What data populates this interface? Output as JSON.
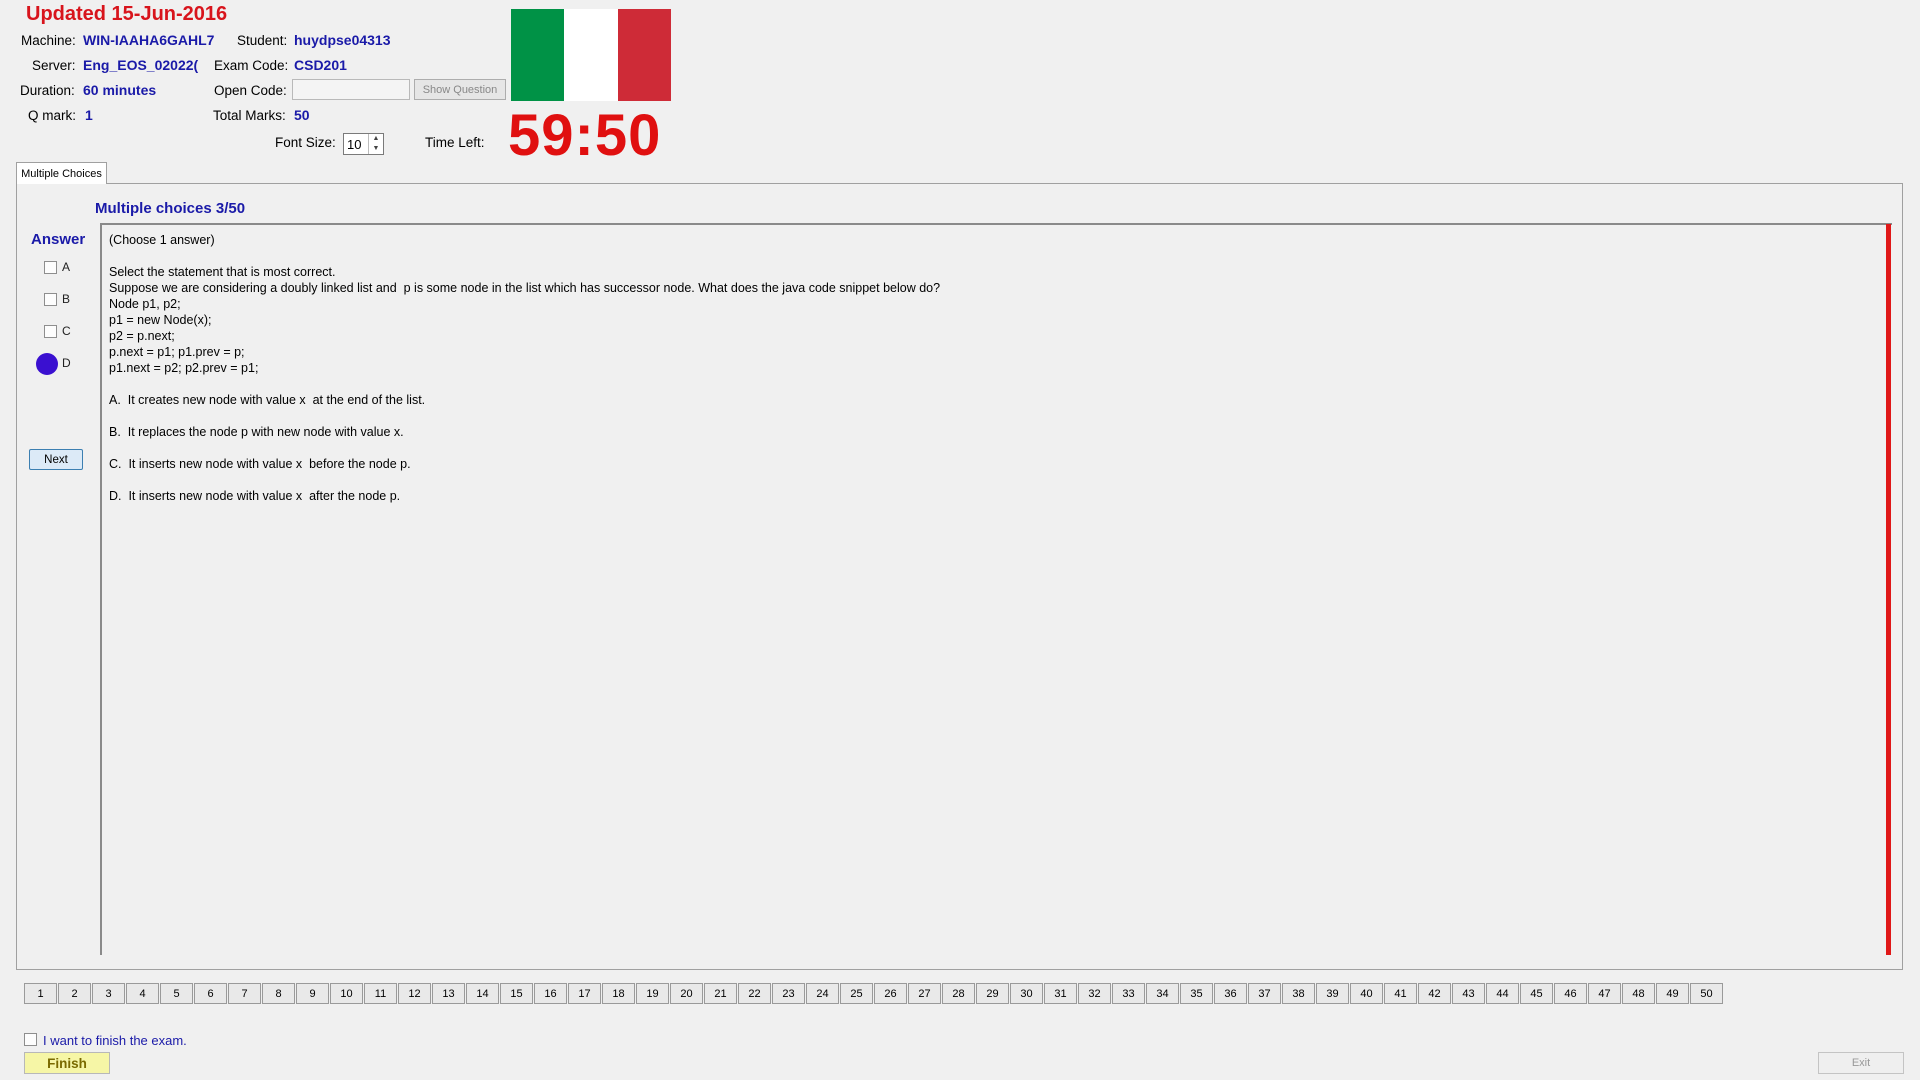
{
  "header": {
    "updated_title": "Updated 15-Jun-2016",
    "machine_label": "Machine:",
    "machine_value": "WIN-IAAHA6GAHL7",
    "student_label": "Student:",
    "student_value": "huydpse04313",
    "server_label": "Server:",
    "server_value": "Eng_EOS_02022(",
    "exam_code_label": "Exam Code:",
    "exam_code_value": "CSD201",
    "duration_label": "Duration:",
    "duration_value": "60 minutes",
    "open_code_label": "Open Code:",
    "open_code_value": "",
    "show_question_label": "Show Question",
    "q_mark_label": "Q mark:",
    "q_mark_value": "1",
    "total_marks_label": "Total Marks:",
    "total_marks_value": "50",
    "font_size_label": "Font Size:",
    "font_size_value": "10",
    "time_left_label": "Time Left:",
    "time_left_value": "59:50",
    "flag_colors": [
      "#009246",
      "#ffffff",
      "#ce2b37"
    ]
  },
  "tabs": [
    {
      "label": "Multiple Choices"
    }
  ],
  "question": {
    "header": "Multiple choices 3/50",
    "answer_label": "Answer",
    "options": [
      "A",
      "B",
      "C",
      "D"
    ],
    "selected": "D",
    "next_label": "Next",
    "lines": [
      "(Choose 1 answer)",
      "",
      "Select the statement that is most correct.",
      "Suppose we are considering a doubly linked list and  p is some node in the list which has successor node. What does the java code snippet below do?",
      "Node p1, p2;",
      "p1 = new Node(x);",
      "p2 = p.next;",
      "p.next = p1; p1.prev = p;",
      "p1.next = p2; p2.prev = p1;",
      "",
      "A.  It creates new node with value x  at the end of the list.",
      "",
      "B.  It replaces the node p with new node with value x.",
      "",
      "C.  It inserts new node with value x  before the node p.",
      "",
      "D.  It inserts new node with value x  after the node p."
    ]
  },
  "nav": {
    "buttons": [
      "1",
      "2",
      "3",
      "4",
      "5",
      "6",
      "7",
      "8",
      "9",
      "10",
      "11",
      "12",
      "13",
      "14",
      "15",
      "16",
      "17",
      "18",
      "19",
      "20",
      "21",
      "22",
      "23",
      "24",
      "25",
      "26",
      "27",
      "28",
      "29",
      "30",
      "31",
      "32",
      "33",
      "34",
      "35",
      "36",
      "37",
      "38",
      "39",
      "40",
      "41",
      "42",
      "43",
      "44",
      "45",
      "46",
      "47",
      "48",
      "49",
      "50"
    ]
  },
  "footer": {
    "finish_checkbox_label": "I want to finish the exam.",
    "finish_label": "Finish",
    "exit_label": "Exit"
  },
  "colors": {
    "accent_blue": "#1a1aa8",
    "timer_red": "#e01010",
    "selected_radio": "#3a10d0"
  }
}
